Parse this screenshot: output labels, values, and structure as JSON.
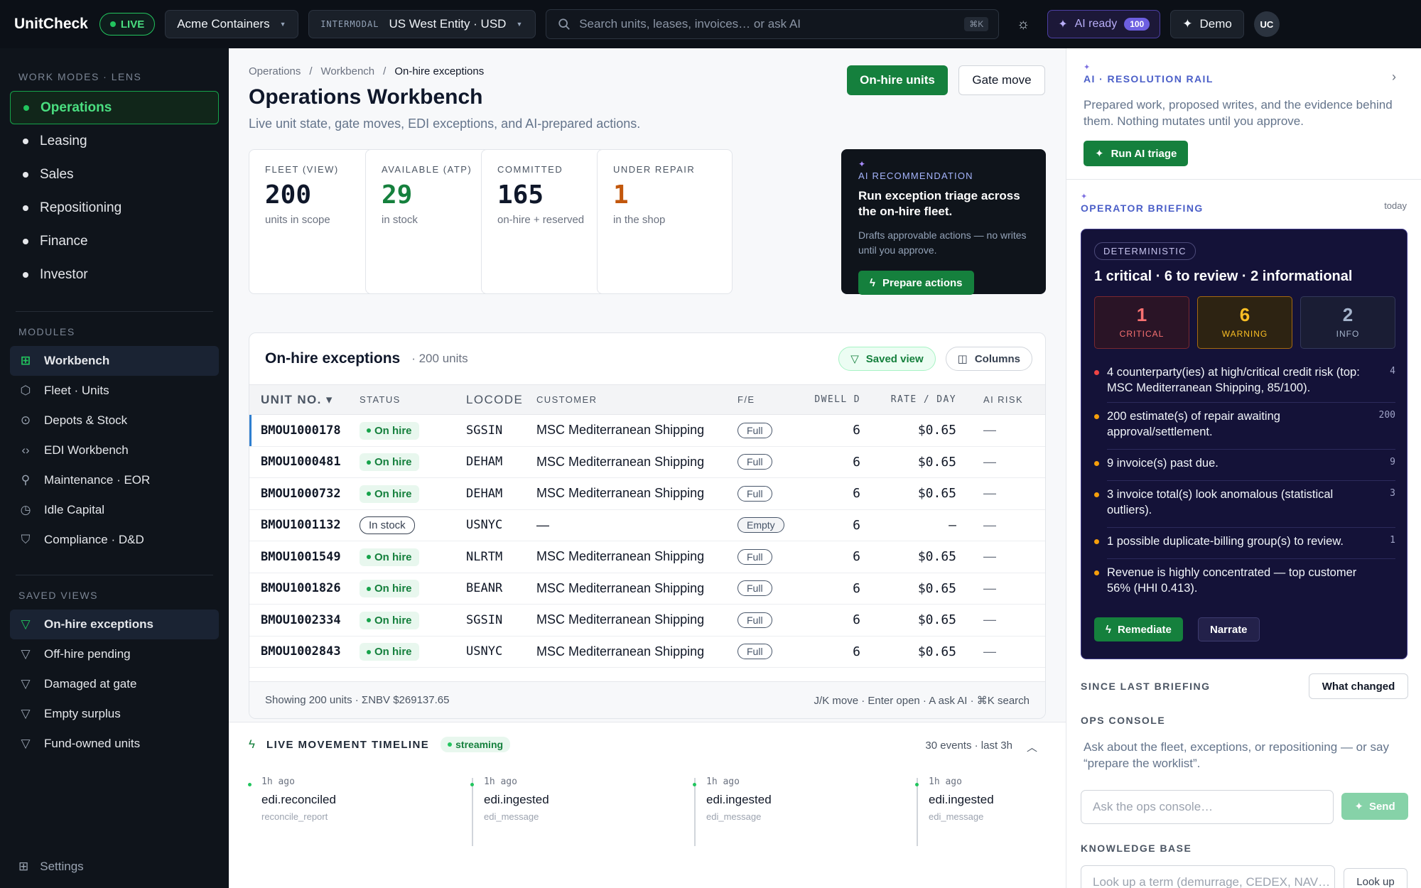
{
  "topbar": {
    "brand": "UnitCheck",
    "live": "LIVE",
    "company": "Acme Containers",
    "entity_tag": "INTERMODAL",
    "entity": "US West Entity · USD",
    "search_placeholder": "Search units, leases, invoices… or ask AI",
    "search_kbd": "⌘K",
    "ai_ready": "AI ready",
    "ai_count": "100",
    "demo": "Demo",
    "avatar": "UC"
  },
  "sidebar": {
    "modes_head": "WORK MODES · LENS",
    "modes": [
      {
        "label": "Operations",
        "active": true
      },
      {
        "label": "Leasing"
      },
      {
        "label": "Sales"
      },
      {
        "label": "Repositioning"
      },
      {
        "label": "Finance"
      },
      {
        "label": "Investor"
      }
    ],
    "modules_head": "MODULES",
    "modules": [
      {
        "label": "Workbench",
        "icon": "grid-icon",
        "active": true
      },
      {
        "label": "Fleet · Units",
        "icon": "cube-icon"
      },
      {
        "label": "Depots & Stock",
        "icon": "pin-icon"
      },
      {
        "label": "EDI Workbench",
        "icon": "code-icon"
      },
      {
        "label": "Maintenance · EOR",
        "icon": "wrench-icon"
      },
      {
        "label": "Idle Capital",
        "icon": "clock-icon"
      },
      {
        "label": "Compliance · D&D",
        "icon": "shield-icon"
      }
    ],
    "saved_head": "SAVED VIEWS",
    "saved": [
      {
        "label": "On-hire exceptions",
        "active": true
      },
      {
        "label": "Off-hire pending"
      },
      {
        "label": "Damaged at gate"
      },
      {
        "label": "Empty surplus"
      },
      {
        "label": "Fund-owned units"
      }
    ],
    "settings": "Settings"
  },
  "main": {
    "breadcrumbs": [
      "Operations",
      "Workbench",
      "On-hire exceptions"
    ],
    "title": "Operations Workbench",
    "subtitle": "Live unit state, gate moves, EDI exceptions, and AI-prepared actions.",
    "btn_onhire": "On-hire units",
    "btn_gate": "Gate move",
    "kpis": [
      {
        "label": "FLEET (VIEW)",
        "value": "200",
        "sub": "units in scope",
        "color": "#0f172a"
      },
      {
        "label": "AVAILABLE (ATP)",
        "value": "29",
        "sub": "in stock",
        "color": "#15803d"
      },
      {
        "label": "COMMITTED",
        "value": "165",
        "sub": "on-hire + reserved",
        "color": "#0f172a"
      },
      {
        "label": "UNDER REPAIR",
        "value": "1",
        "sub": "in the shop",
        "color": "#c2570c"
      }
    ],
    "ai_card": {
      "label": "AI RECOMMENDATION",
      "title": "Run exception triage across the on-hire fleet.",
      "desc": "Drafts approvable actions — no writes until you approve.",
      "action": "Prepare actions"
    }
  },
  "table": {
    "title": "On-hire exceptions",
    "count": "· 200 units",
    "saved_view": "Saved view",
    "columns_btn": "Columns",
    "headers": [
      "UNIT NO. ▾",
      "STATUS",
      "LOCODE",
      "CUSTOMER",
      "F/E",
      "DWELL D",
      "RATE / DAY",
      "AI RISK"
    ],
    "rows": [
      {
        "unit": "BMOU1000178",
        "status": "On hire",
        "loc": "SGSIN",
        "cust": "MSC Mediterranean Shipping",
        "fe": "Full",
        "dwell": "6",
        "rate": "$0.65",
        "risk": "—"
      },
      {
        "unit": "BMOU1000481",
        "status": "On hire",
        "loc": "DEHAM",
        "cust": "MSC Mediterranean Shipping",
        "fe": "Full",
        "dwell": "6",
        "rate": "$0.65",
        "risk": "—"
      },
      {
        "unit": "BMOU1000732",
        "status": "On hire",
        "loc": "DEHAM",
        "cust": "MSC Mediterranean Shipping",
        "fe": "Full",
        "dwell": "6",
        "rate": "$0.65",
        "risk": "—"
      },
      {
        "unit": "BMOU1001132",
        "status": "In stock",
        "loc": "USNYC",
        "cust": "—",
        "fe": "Empty",
        "dwell": "6",
        "rate": "–",
        "risk": "—"
      },
      {
        "unit": "BMOU1001549",
        "status": "On hire",
        "loc": "NLRTM",
        "cust": "MSC Mediterranean Shipping",
        "fe": "Full",
        "dwell": "6",
        "rate": "$0.65",
        "risk": "—"
      },
      {
        "unit": "BMOU1001826",
        "status": "On hire",
        "loc": "BEANR",
        "cust": "MSC Mediterranean Shipping",
        "fe": "Full",
        "dwell": "6",
        "rate": "$0.65",
        "risk": "—"
      },
      {
        "unit": "BMOU1002334",
        "status": "On hire",
        "loc": "SGSIN",
        "cust": "MSC Mediterranean Shipping",
        "fe": "Full",
        "dwell": "6",
        "rate": "$0.65",
        "risk": "—"
      },
      {
        "unit": "BMOU1002843",
        "status": "On hire",
        "loc": "USNYC",
        "cust": "MSC Mediterranean Shipping",
        "fe": "Full",
        "dwell": "6",
        "rate": "$0.65",
        "risk": "—"
      }
    ],
    "footer": "Showing 200 units · ΣNBV $269137.65",
    "footer_hint": "J/K move · Enter open · A ask AI · ⌘K search"
  },
  "timeline": {
    "title": "LIVE MOVEMENT TIMELINE",
    "stream": "streaming",
    "meta": "30 events · last 3h",
    "events": [
      {
        "ago": "1h ago",
        "name": "edi.reconciled",
        "src": "reconcile_report"
      },
      {
        "ago": "1h ago",
        "name": "edi.ingested",
        "src": "edi_message"
      },
      {
        "ago": "1h ago",
        "name": "edi.ingested",
        "src": "edi_message"
      },
      {
        "ago": "1h ago",
        "name": "edi.ingested",
        "src": "edi_message"
      }
    ]
  },
  "rail": {
    "label": "AI · RESOLUTION RAIL",
    "desc": "Prepared work, proposed writes, and the evidence behind them. Nothing mutates until you approve.",
    "run_btn": "Run AI triage",
    "brief_label": "OPERATOR BRIEFING",
    "brief_when": "today",
    "deterministic": "DETERMINISTIC",
    "brief_title": "1 critical · 6 to review · 2 informational",
    "sev": [
      {
        "n": "1",
        "t": "CRITICAL"
      },
      {
        "n": "6",
        "t": "WARNING"
      },
      {
        "n": "2",
        "t": "INFO"
      }
    ],
    "items": [
      {
        "text": "4 counterparty(ies) at high/critical credit risk (top: MSC Mediterranean Shipping, 85/100).",
        "count": "4",
        "color": "#ef4444"
      },
      {
        "text": "200 estimate(s) of repair awaiting approval/settlement.",
        "count": "200",
        "color": "#f59e0b"
      },
      {
        "text": "9 invoice(s) past due.",
        "count": "9",
        "color": "#f59e0b"
      },
      {
        "text": "3 invoice total(s) look anomalous (statistical outliers).",
        "count": "3",
        "color": "#f59e0b"
      },
      {
        "text": "1 possible duplicate-billing group(s) to review.",
        "count": "1",
        "color": "#f59e0b"
      },
      {
        "text": "Revenue is highly concentrated — top customer 56% (HHI 0.413).",
        "count": "",
        "color": "#f59e0b"
      }
    ],
    "remediate": "Remediate",
    "narrate": "Narrate",
    "since": "SINCE LAST BRIEFING",
    "what_changed": "What changed",
    "console_head": "OPS CONSOLE",
    "console_desc": "Ask about the fleet, exceptions, or repositioning — or say “prepare the worklist”.",
    "console_placeholder": "Ask the ops console…",
    "send": "Send",
    "kb_head": "KNOWLEDGE BASE",
    "kb_placeholder": "Look up a term (demurrage, CEDEX, NAV…",
    "lookup": "Look up"
  }
}
